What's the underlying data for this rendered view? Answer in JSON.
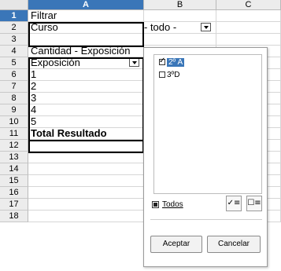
{
  "columns": [
    "A",
    "B",
    "C"
  ],
  "rows": [
    "1",
    "2",
    "3",
    "4",
    "5",
    "6",
    "7",
    "8",
    "9",
    "10",
    "11",
    "12",
    "13",
    "14",
    "15",
    "16",
    "17",
    "18"
  ],
  "cells": {
    "a1": "Filtrar",
    "a2": "Curso",
    "b2": "- todo -",
    "a4": "Cantidad - Exposición",
    "a5": "Exposición",
    "a6": "1",
    "a7": "2",
    "a8": "3",
    "a9": "4",
    "a10": "5",
    "a11": "Total Resultado"
  },
  "popup": {
    "items": [
      {
        "label": "2º A",
        "checked": true,
        "selected": true
      },
      {
        "label": "3ºD",
        "checked": false,
        "selected": false
      }
    ],
    "todos_prefix": "",
    "todos_label": "Todos",
    "accept_label": "Aceptar",
    "cancel_label": "Cancelar",
    "icons": [
      "select-checked-icon",
      "select-unchecked-icon"
    ]
  },
  "colors": {
    "selection": "#3a76b8"
  }
}
